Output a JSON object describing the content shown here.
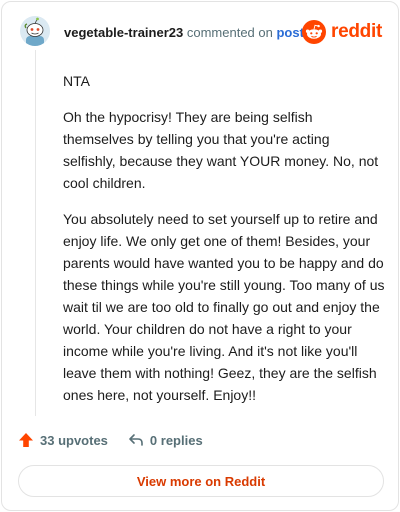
{
  "header": {
    "author": "vegetable-trainer23",
    "commented_text": "commented on",
    "post_link": "post",
    "brand_name": "reddit",
    "brand_color": "#ff4500",
    "avatar_icon": "snoo-avatar-icon"
  },
  "comment": {
    "paragraphs": [
      "NTA",
      "Oh the hypocrisy! They are being selfish themselves by telling you that you're acting selfishly, because they want YOUR money. No, not cool children.",
      "You absolutely need to set yourself up to retire and enjoy life. We only get one of them! Besides, your parents would have wanted you to be happy and do these things while you're still young. Too many of us wait til we are too old to finally go out and enjoy the world. Your children do not have a right to your income while you're living. And it's not like you'll leave them with nothing! Geez, they are the selfish ones here, not yourself. Enjoy!!"
    ]
  },
  "actions": {
    "upvotes_label": "33 upvotes",
    "replies_label": "0 replies",
    "upvote_icon": "upvote-arrow-icon",
    "reply_icon": "reply-arrow-icon"
  },
  "footer": {
    "view_more_label": "View more on Reddit"
  }
}
